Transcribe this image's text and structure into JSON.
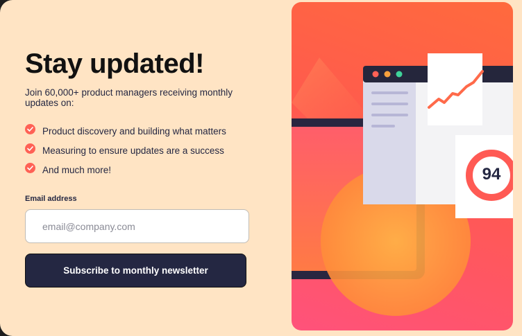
{
  "header": {
    "title": "Stay updated!",
    "intro": "Join 60,000+ product managers receiving monthly updates on:"
  },
  "features": [
    "Product discovery and building what matters",
    "Measuring to ensure updates are a success",
    "And much more!"
  ],
  "form": {
    "email_label": "Email address",
    "email_placeholder": "email@company.com",
    "email_value": "",
    "subscribe_label": "Subscribe to monthly newsletter"
  },
  "illustration": {
    "score": "94",
    "icons": [
      "check-icon",
      "trend-line-icon",
      "score-gauge-icon"
    ]
  },
  "colors": {
    "background": "#ffe4c4",
    "accent": "#ff6155",
    "dark_navy": "#242742",
    "gradient_top": "#ff6a3d",
    "gradient_bottom": "#ff527b"
  }
}
